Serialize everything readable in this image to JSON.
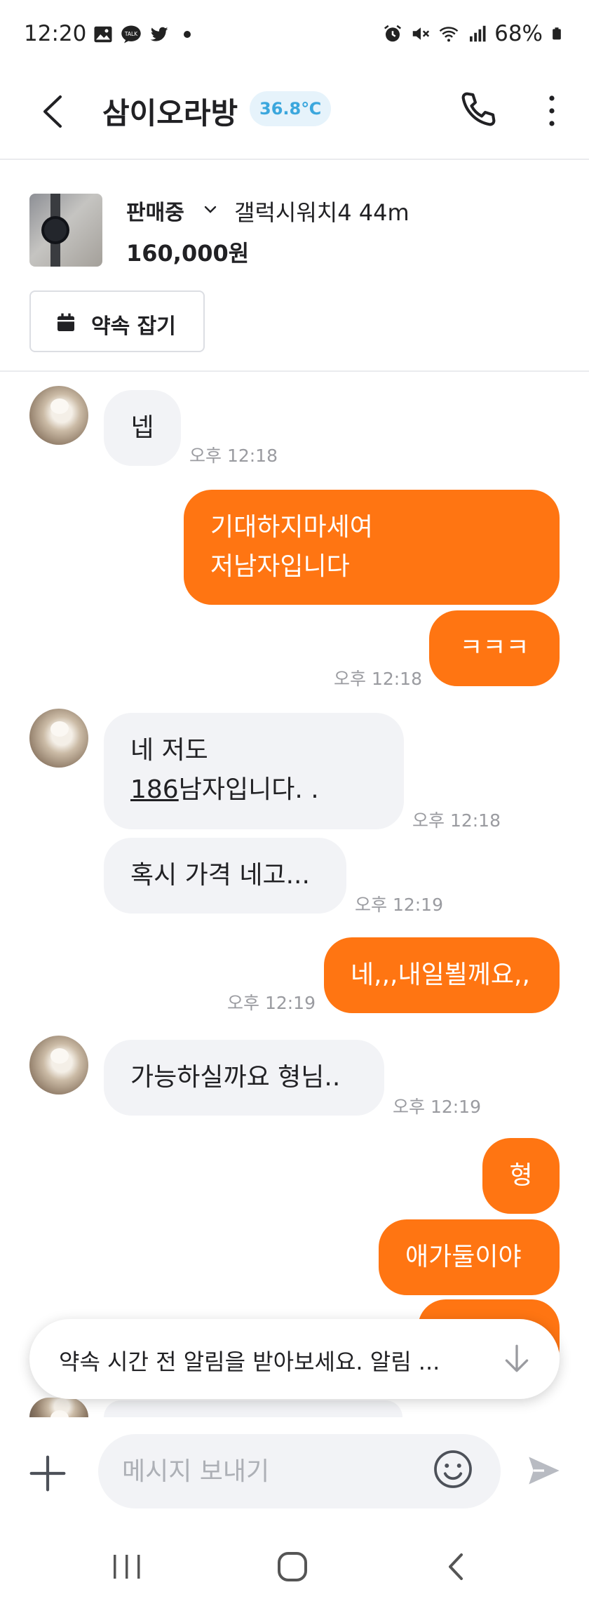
{
  "status_bar": {
    "time": "12:20",
    "battery": "68%",
    "left_icons": [
      "gallery-icon",
      "talk-icon",
      "twitter-icon",
      "dot-icon"
    ],
    "right_icons": [
      "alarm-icon",
      "mute-icon",
      "wifi-icon",
      "signal-icon",
      "battery-icon"
    ]
  },
  "header": {
    "title": "삼이오라방",
    "temperature": "36.8℃",
    "colors": {
      "temp_badge_bg": "#e6f3fb",
      "temp_badge_text": "#3ba7dd"
    }
  },
  "product": {
    "status": "판매중",
    "name": "갤럭시워치4 44m",
    "price": "160,000원",
    "appointment_label": "약속 잡기"
  },
  "messages": [
    {
      "side": "in",
      "lines": [
        "넵"
      ],
      "time": "오후 12:18"
    },
    {
      "side": "out",
      "lines": [
        "기대하지마세여",
        "저남자입니다"
      ],
      "time": ""
    },
    {
      "side": "out",
      "lines": [
        "ㅋㅋㅋ"
      ],
      "time": "오후 12:18"
    },
    {
      "side": "in",
      "lines": [
        "네 저도",
        "186남자입니다. ."
      ],
      "time": "오후 12:18"
    },
    {
      "side": "in",
      "lines": [
        "혹시 가격 네고..."
      ],
      "time": "오후 12:19"
    },
    {
      "side": "out",
      "lines": [
        "네,,,내일뵐께요,,"
      ],
      "time": "오후 12:19"
    },
    {
      "side": "in",
      "lines": [
        "가능하실까요 형님.."
      ],
      "time": "오후 12:19"
    },
    {
      "side": "out",
      "lines": [
        "형"
      ],
      "time": ""
    },
    {
      "side": "out",
      "lines": [
        "애가둘이야"
      ],
      "time": ""
    }
  ],
  "reminder": {
    "text": "약속 시간 전 알림을 받아보세요. 알림 ..."
  },
  "input": {
    "placeholder": "메시지 보내기"
  },
  "colors": {
    "outgoing_bubble": "#ff7512",
    "incoming_bubble": "#f2f3f6",
    "timestamp": "#9a9ba0"
  }
}
